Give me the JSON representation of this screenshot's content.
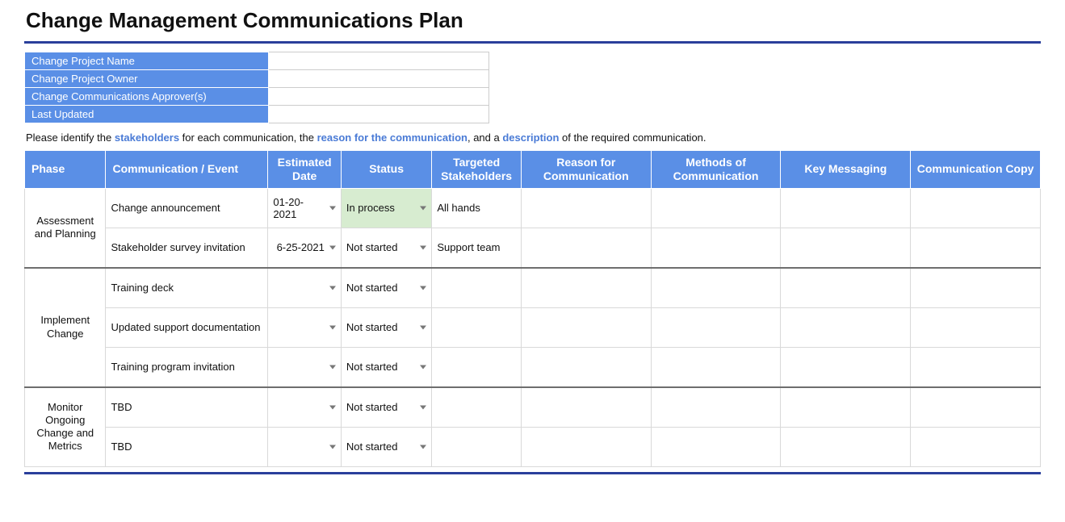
{
  "title": "Change Management Communications Plan",
  "meta_labels": {
    "project_name": "Change Project Name",
    "project_owner": "Change Project Owner",
    "approvers": "Change Communications Approver(s)",
    "last_updated": "Last Updated"
  },
  "meta_values": {
    "project_name": "",
    "project_owner": "",
    "approvers": "",
    "last_updated": ""
  },
  "instruction": {
    "pre": "Please identify the ",
    "link1": "stakeholders",
    "mid1": " for each communication, the ",
    "link2": "reason for the communication",
    "mid2": ", and a ",
    "link3": "description",
    "post": " of the required communication."
  },
  "columns": {
    "phase": "Phase",
    "event": "Communication / Event",
    "date": "Estimated Date",
    "status": "Status",
    "stakeholders": "Targeted Stakeholders",
    "reason": "Reason for Communication",
    "methods": "Methods of Communication",
    "messaging": "Key Messaging",
    "copy": "Communication Copy"
  },
  "phases": [
    {
      "name": "Assessment and Planning",
      "rows": [
        {
          "event": "Change announcement",
          "date": "01-20-2021",
          "status": "In process",
          "stakeholders": "All hands",
          "reason": "",
          "methods": "",
          "messaging": "",
          "copy": ""
        },
        {
          "event": "Stakeholder survey invitation",
          "date": "6-25-2021",
          "status": "Not started",
          "stakeholders": "Support team",
          "reason": "",
          "methods": "",
          "messaging": "",
          "copy": ""
        }
      ]
    },
    {
      "name": "Implement Change",
      "rows": [
        {
          "event": "Training deck",
          "date": "",
          "status": "Not started",
          "stakeholders": "",
          "reason": "",
          "methods": "",
          "messaging": "",
          "copy": ""
        },
        {
          "event": "Updated support documentation",
          "date": "",
          "status": "Not started",
          "stakeholders": "",
          "reason": "",
          "methods": "",
          "messaging": "",
          "copy": ""
        },
        {
          "event": "Training program invitation",
          "date": "",
          "status": "Not started",
          "stakeholders": "",
          "reason": "",
          "methods": "",
          "messaging": "",
          "copy": ""
        }
      ]
    },
    {
      "name": "Monitor Ongoing Change and Metrics",
      "rows": [
        {
          "event": "TBD",
          "date": "",
          "status": "Not started",
          "stakeholders": "",
          "reason": "",
          "methods": "",
          "messaging": "",
          "copy": ""
        },
        {
          "event": "TBD",
          "date": "",
          "status": "Not started",
          "stakeholders": "",
          "reason": "",
          "methods": "",
          "messaging": "",
          "copy": ""
        }
      ]
    }
  ]
}
